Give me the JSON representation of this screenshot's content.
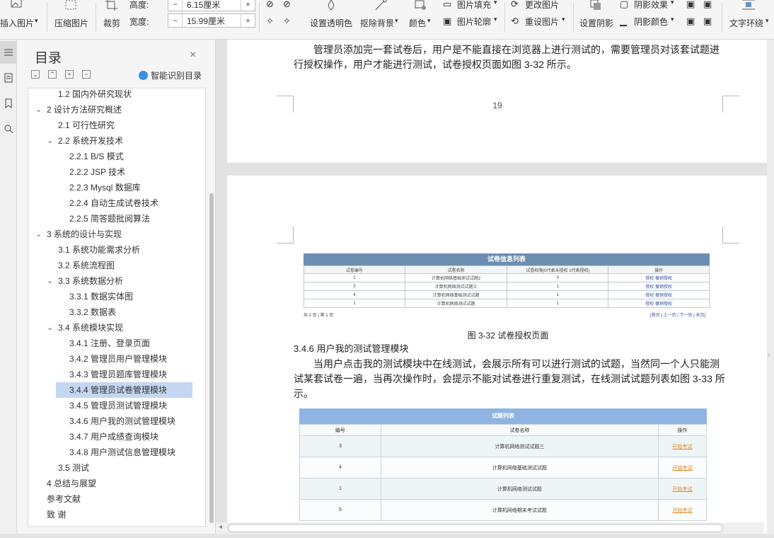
{
  "ribbon": {
    "insert_image": "插入图片",
    "compress": "压缩图片",
    "crop": "裁剪",
    "height_label": "高度:",
    "height_value": "6.15厘米",
    "width_label": "宽度:",
    "width_value": "15.99厘米",
    "transparency": "设置透明色",
    "remove_bg": "抠除背景",
    "color": "颜色",
    "fill": "图片填充",
    "outline": "图片轮廓",
    "change_image": "更改图片",
    "reset_image": "重设图片",
    "shadow_set": "设置阴影",
    "shadow_effect": "阴影效果",
    "shadow_color": "阴影颜色",
    "wrap": "文字环绕",
    "minus": "−",
    "plus": "+"
  },
  "toc": {
    "title": "目录",
    "close": "×",
    "ai_label": "智能识别目录",
    "items": [
      {
        "text": "1.2  国内外研究现状"
      },
      {
        "text": "2  设计方法研究概述"
      },
      {
        "text": "2.1  可行性研究"
      },
      {
        "text": "2.2  系统开发技术"
      },
      {
        "text": "2.2.1    B/S 模式"
      },
      {
        "text": "2.2.2 JSP 技术"
      },
      {
        "text": "2.2.3 Mysql 数据库"
      },
      {
        "text": "2.2.4  自动生成试卷技术"
      },
      {
        "text": "2.2.5  简答题批阅算法"
      },
      {
        "text": "3  系统的设计与实现"
      },
      {
        "text": "3.1  系统功能需求分析"
      },
      {
        "text": "3.2  系统流程图"
      },
      {
        "text": "3.3  系统数据分析"
      },
      {
        "text": "3.3.1    数据实体图"
      },
      {
        "text": "3.3.2    数据表"
      },
      {
        "text": "3.4  系统模块实现"
      },
      {
        "text": "3.4.1  注册、登录页面"
      },
      {
        "text": "3.4.2  管理员用户管理模块"
      },
      {
        "text": "3.4.3  管理员题库管理模块"
      },
      {
        "text": "3.4.4  管理员试卷管理模块"
      },
      {
        "text": "3.4.5  管理员测试管理模块"
      },
      {
        "text": "3.4.6 用户我的测试管理模块"
      },
      {
        "text": "3.4.7 用户成绩查询模块"
      },
      {
        "text": "3.4.8 用户测试信息管理模块"
      },
      {
        "text": "3.5  测试"
      },
      {
        "text": "4  总结与展望"
      },
      {
        "text": "参考文献"
      },
      {
        "text": "致    谢"
      }
    ]
  },
  "document": {
    "page1_para": "管理员添加完一套试卷后，用户是不能直接在浏览器上进行测试的，需要管理员对该套试题进",
    "page1_para2": "行授权操作，用户才能进行测试，试卷授权页面如图 3-32 所示。",
    "page_number": "19",
    "fig1": {
      "title": "试卷信息列表",
      "headers": [
        "试卷编号",
        "试卷名称",
        "试卷权限(0代表未授权  1代表授权)",
        "操作"
      ],
      "rows": [
        [
          "2",
          "计算机网络基础测试试题2",
          "0",
          "授权  撤销授权"
        ],
        [
          "3",
          "计算机网络测试试题三",
          "1",
          "授权  撤销授权"
        ],
        [
          "4",
          "计算机网络基础测试试题",
          "1",
          "授权  撤销授权"
        ],
        [
          "1",
          "计算机网络测试试题",
          "1",
          "授权  撤销授权"
        ]
      ],
      "pager_left": "共 2 页 | 第 1 页",
      "pager_right": "[首页 | 上一页 | 下一页 | 末页]"
    },
    "fig1_caption": "图 3-32 试卷授权页面",
    "section_heading": "3.4.6 用户我的测试管理模块",
    "para2_line1": "当用户点击我的测试模块中在线测试，会展示所有可以进行测试的试题，当然同一个人只能测",
    "para2_line2": "试某套试卷一遍，当再次操作时，会提示不能对试卷进行重复测试，在线测试试题列表如图 3-33 所",
    "para2_line3": "示。",
    "fig2": {
      "title": "试题列表",
      "headers": [
        "编号",
        "试卷名称",
        "操作"
      ],
      "rows": [
        [
          "3",
          "计算机网络测试试题三",
          "开始考试"
        ],
        [
          "4",
          "计算机网络基础测试试题",
          "开始考试"
        ],
        [
          "1",
          "计算机网络测试试题",
          "开始考试"
        ],
        [
          "5",
          "计算机网络期末考试试题",
          "开始考试"
        ]
      ]
    }
  },
  "colors": {
    "fig1_title_bg": "#6b8fb0",
    "fig2_title_bg": "#8fb3e3",
    "toc_selected": "#c4d7f2"
  }
}
